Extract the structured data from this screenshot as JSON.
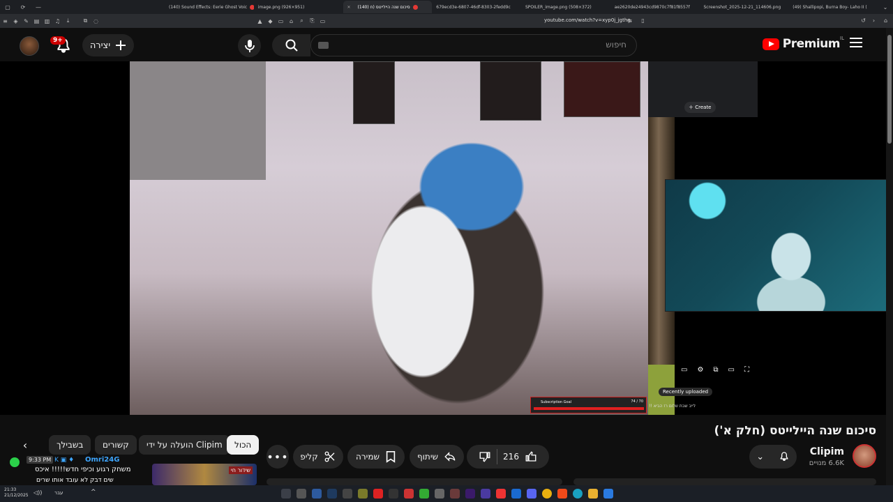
{
  "browser": {
    "tabs": [
      {
        "title": "(140) Sound Effects: Eerie Ghost Voic"
      },
      {
        "title": "image.png (926×951)"
      },
      {
        "title": "(140) סיכום שנה היילייטס (ח"
      },
      {
        "title": "679ecd3e-6807-46df-8303-2fedd9c"
      },
      {
        "title": "SPOILER_image.png (508×372)"
      },
      {
        "title": "ae2620de24943cd9870c7f81f8557f"
      },
      {
        "title": "Screenshot_2025-12-21_114606.png"
      },
      {
        "title": "(49) Shallipopi, Burna Boy- Laho II ("
      }
    ],
    "url": "youtube.com/watch?v=xyp0j_jgthg"
  },
  "header": {
    "logo_text": "Premium",
    "country": "IL",
    "search_placeholder": "חיפוש",
    "create_label": "יצירה",
    "notif_count": "9+"
  },
  "player": {
    "overlay_create": "Create",
    "recently_uploaded": "Recently uploaded",
    "live_text": "!! לייב שבת שלום רז הביא",
    "sub_goal_label": "Subscription Goal",
    "sub_goal_count": "74 / 70",
    "sub_goal_fraction": 1.0
  },
  "video": {
    "title": "סיכום שנה היילייטס (חלק א')",
    "channel": "Clipim",
    "subscribers": "6.6K מנויים",
    "likes": "216",
    "share_label": "שיתוף",
    "save_label": "שמירה",
    "clip_label": "קליפ"
  },
  "chips": {
    "all": "הכול",
    "uploaded_by": "הועלה על ידי Clipim",
    "related": "קשורים",
    "for_you": "בשבילך"
  },
  "chat": {
    "time": "9:33 PM",
    "user": "Omri24G",
    "message": "משחק רגוע וכיפי חדש!!!!!  איכס",
    "message2": "שים דבק לא עובד אותו שרים"
  },
  "ad": {
    "label": "שידור חי"
  },
  "taskbar": {
    "time": "21:33",
    "date": "21/12/2025",
    "lang": "עבר"
  },
  "colors": {
    "yt_red": "#ff0000",
    "background": "#0f0f0f",
    "pill": "#272727",
    "link_blue": "#3ea6ff"
  }
}
